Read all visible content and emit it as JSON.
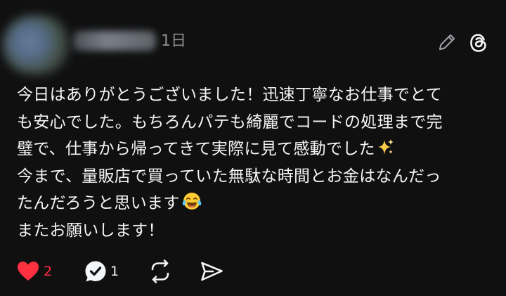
{
  "post": {
    "timestamp": "1日",
    "text_lines": [
      "今日はありがとうございました！迅速丁寧なお仕事でとて",
      "も安心でした。もちろんパテも綺麗でコードの処理まで完",
      "璧で、仕事から帰ってきて実際に見て感動でした",
      "今まで、量販店で買っていた無駄な時間とお金はなんだっ",
      "たんだろうと思います",
      "またお願いします！"
    ],
    "emoji_sparkles": "sparkles",
    "emoji_tears_of_joy": "face-with-tears-of-joy"
  },
  "actions": {
    "like_count": "2",
    "reply_count": "1"
  },
  "icons": {
    "edit": "pencil-icon",
    "threads": "threads-logo-icon",
    "like": "heart-icon",
    "reply": "reply-bubble-icon",
    "repost": "repost-icon",
    "share": "share-icon"
  },
  "colors": {
    "background": "#101010",
    "text": "#f3f5f7",
    "muted": "#8a8d91",
    "like": "#ff3040"
  }
}
